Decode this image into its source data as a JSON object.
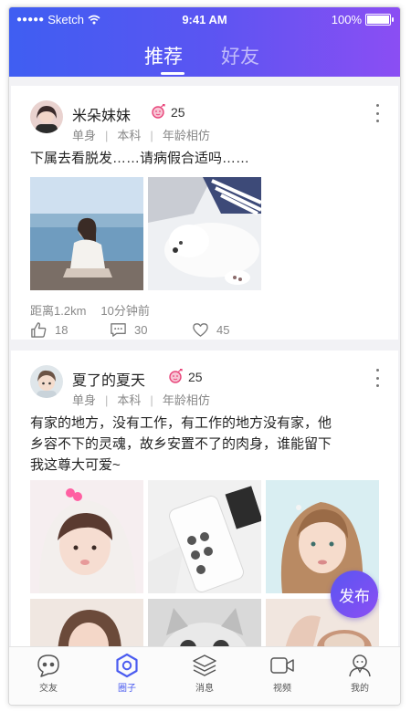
{
  "status_bar": {
    "carrier_dots": "●●●●●",
    "carrier": "Sketch",
    "time": "9:41 AM",
    "battery": "100%",
    "battery_level": 1.0
  },
  "tabs": [
    {
      "label": "推荐",
      "active": true
    },
    {
      "label": "好友",
      "active": false
    }
  ],
  "posts": [
    {
      "name": "米朵妹妹",
      "age": "25",
      "status": "单身",
      "education": "本科",
      "preference": "年龄相仿",
      "text": "下属去看脱发……请病假合适吗……",
      "distance": "距离1.2km",
      "time_ago": "10分钟前",
      "likes": "18",
      "comments": "30",
      "favorites": "45"
    },
    {
      "name": "夏了的夏天",
      "age": "25",
      "status": "单身",
      "education": "本科",
      "preference": "年龄相仿",
      "text_lines": [
        "有家的地方，没有工作，有工作的地方没有家，他",
        "乡容不下的灵魂，故乡安置不了的肉身，谁能留下",
        "我这尊大可爱~"
      ]
    }
  ],
  "fab_label": "发布",
  "bottom_nav": [
    {
      "label": "交友",
      "icon": "chat-face-icon",
      "active": false
    },
    {
      "label": "圈子",
      "icon": "hexagon-circle-icon",
      "active": true
    },
    {
      "label": "消息",
      "icon": "layers-icon",
      "active": false
    },
    {
      "label": "视频",
      "icon": "video-camera-icon",
      "active": false
    },
    {
      "label": "我的",
      "icon": "user-icon",
      "active": false
    }
  ],
  "colors": {
    "gradient_start": "#3f5ef2",
    "gradient_end": "#8b4ef3",
    "accent": "#4b5cf0",
    "badge_pink": "#e8457a"
  }
}
